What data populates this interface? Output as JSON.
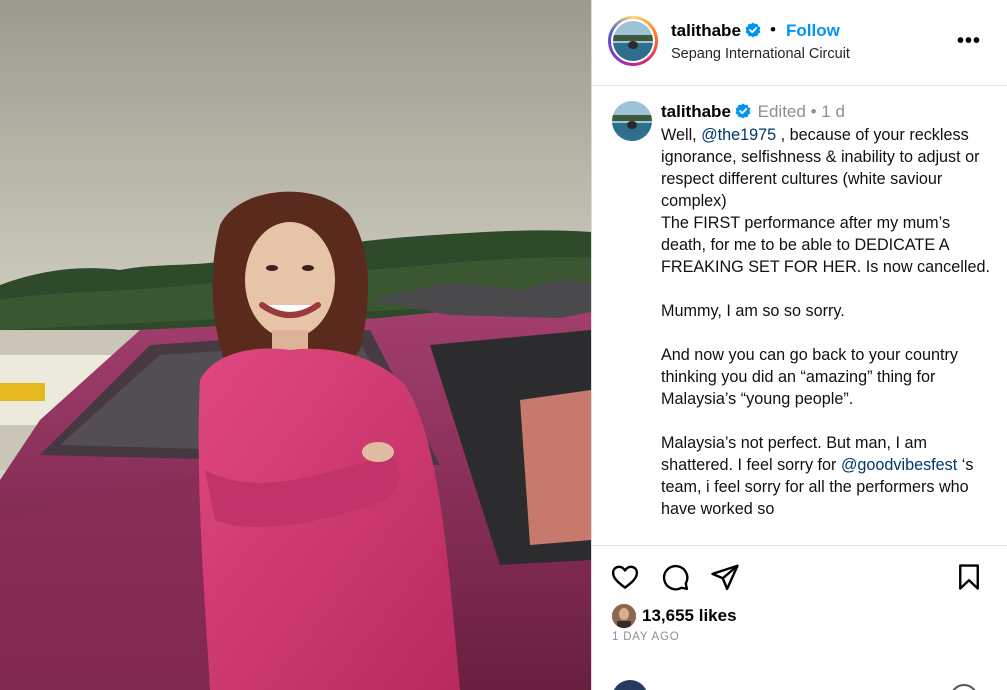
{
  "header": {
    "username": "talithabe",
    "follow_label": "Follow",
    "separator": "•",
    "location": "Sepang International Circuit",
    "more_label": "•••"
  },
  "caption": {
    "username": "talithabe",
    "edited": "Edited",
    "separator": "•",
    "time": "1 d",
    "line1_prefix": "Well, ",
    "mention1": "@the1975",
    "line1_suffix": " , because of your reckless ignorance, selfishness & inability to adjust or respect different cultures (white saviour complex)",
    "line2": "The FIRST performance after my mum’s death, for me to be able to DEDICATE A FREAKING SET FOR HER. Is now cancelled.",
    "para2": "Mummy, I am so so sorry.",
    "para3": "And now you can go back to your country thinking you did an “amazing” thing for Malaysia’s “young people”.",
    "para4_prefix": "Malaysia’s not perfect. But man, I am shattered. I feel sorry for ",
    "mention2": "@goodvibesfest",
    "para4_suffix": " ‘s team, i feel sorry for all the performers who have worked so"
  },
  "actions": {
    "like_icon": "heart-icon",
    "comment_icon": "comment-icon",
    "share_icon": "share-icon",
    "save_icon": "bookmark-icon",
    "likes": "13,655 likes",
    "posted": "1 DAY AGO"
  },
  "colors": {
    "accent": "#0095f6",
    "mention": "#00376b",
    "muted": "#8e8e8e",
    "verified": "#0095f6"
  }
}
